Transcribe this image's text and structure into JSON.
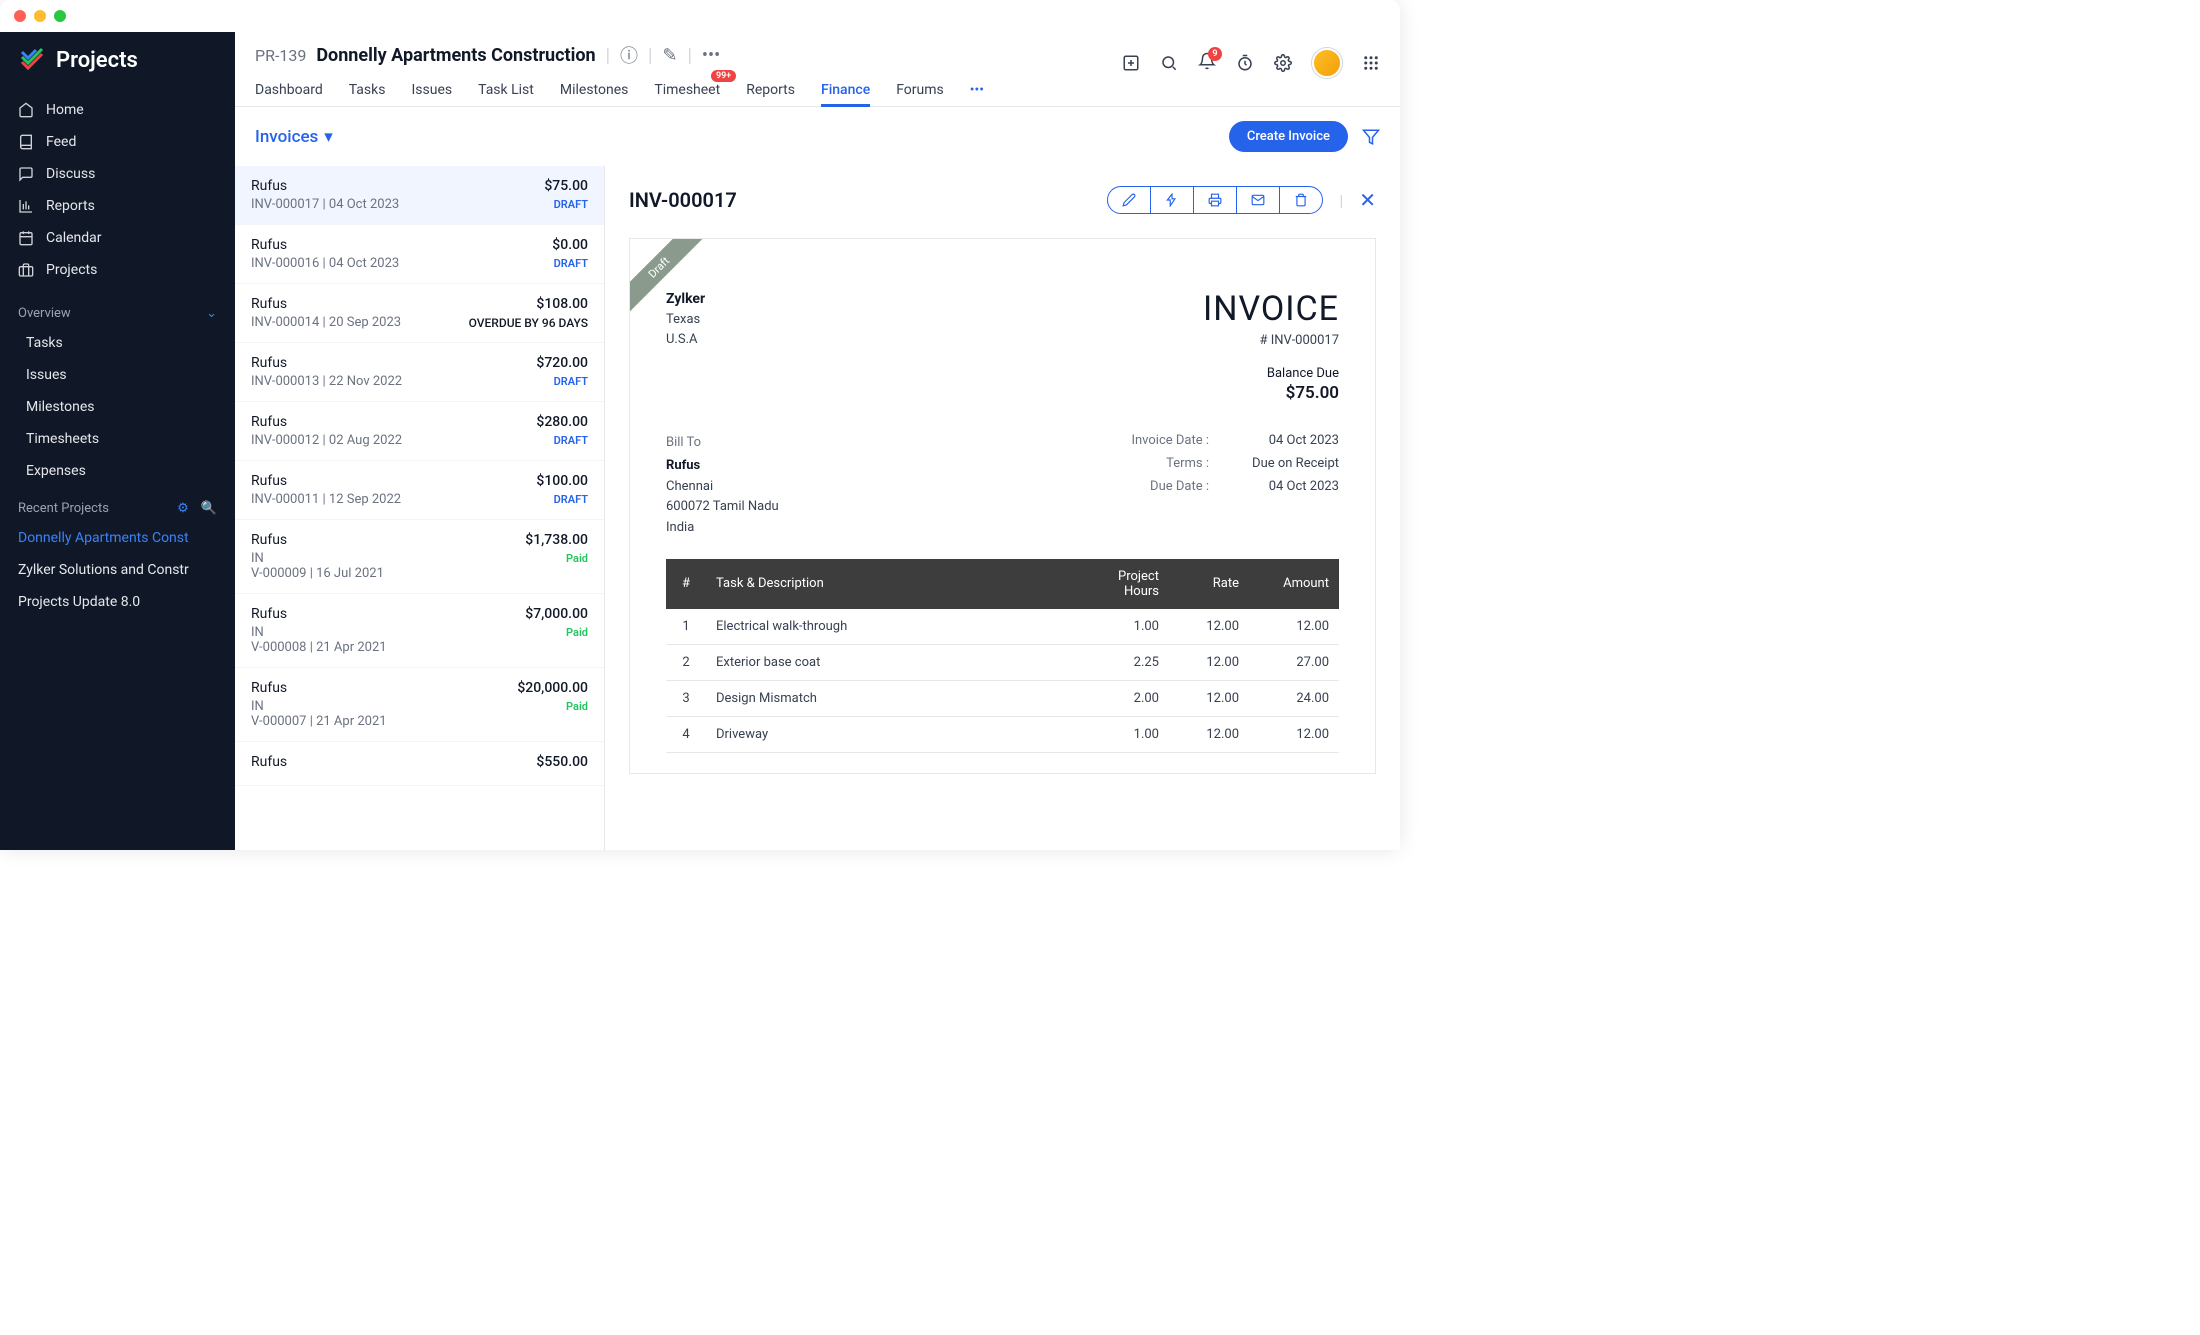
{
  "brand": "Projects",
  "sidebar": {
    "nav": [
      {
        "label": "Home"
      },
      {
        "label": "Feed"
      },
      {
        "label": "Discuss"
      },
      {
        "label": "Reports"
      },
      {
        "label": "Calendar"
      },
      {
        "label": "Projects"
      }
    ],
    "overview_label": "Overview",
    "overview_items": [
      {
        "label": "Tasks"
      },
      {
        "label": "Issues"
      },
      {
        "label": "Milestones"
      },
      {
        "label": "Timesheets"
      },
      {
        "label": "Expenses"
      }
    ],
    "recent_label": "Recent Projects",
    "recent": [
      {
        "label": "Donnelly Apartments Const",
        "active": true
      },
      {
        "label": "Zylker Solutions and Constr"
      },
      {
        "label": "Projects Update 8.0"
      }
    ]
  },
  "project": {
    "id": "PR-139",
    "name": "Donnelly Apartments Construction"
  },
  "tabs": [
    {
      "label": "Dashboard"
    },
    {
      "label": "Tasks"
    },
    {
      "label": "Issues"
    },
    {
      "label": "Task List"
    },
    {
      "label": "Milestones"
    },
    {
      "label": "Timesheet",
      "badge": "99+"
    },
    {
      "label": "Reports"
    },
    {
      "label": "Finance",
      "active": true
    },
    {
      "label": "Forums"
    }
  ],
  "bell_count": "9",
  "subhead": {
    "dropdown": "Invoices",
    "create_btn": "Create Invoice"
  },
  "invoices": [
    {
      "client": "Rufus",
      "amount": "$75.00",
      "meta": "INV-000017 | 04 Oct 2023",
      "status": "DRAFT",
      "status_class": "st-draft",
      "selected": true
    },
    {
      "client": "Rufus",
      "amount": "$0.00",
      "meta": "INV-000016 | 04 Oct 2023",
      "status": "DRAFT",
      "status_class": "st-draft"
    },
    {
      "client": "Rufus",
      "amount": "$108.00",
      "meta": "INV-000014 | 20 Sep 2023",
      "status": "OVERDUE BY 96 DAYS",
      "status_class": "st-overdue"
    },
    {
      "client": "Rufus",
      "amount": "$720.00",
      "meta": "INV-000013 | 22 Nov 2022",
      "status": "DRAFT",
      "status_class": "st-draft"
    },
    {
      "client": "Rufus",
      "amount": "$280.00",
      "meta": "INV-000012 | 02 Aug 2022",
      "status": "DRAFT",
      "status_class": "st-draft"
    },
    {
      "client": "Rufus",
      "amount": "$100.00",
      "meta": "INV-000011 | 12 Sep 2022",
      "status": "DRAFT",
      "status_class": "st-draft"
    },
    {
      "client": "Rufus",
      "amount": "$1,738.00",
      "meta": "IN\nV-000009 | 16 Jul 2021",
      "status": "Paid",
      "status_class": "st-paid",
      "multi": true
    },
    {
      "client": "Rufus",
      "amount": "$7,000.00",
      "meta": "IN\nV-000008 | 21 Apr 2021",
      "status": "Paid",
      "status_class": "st-paid",
      "multi": true
    },
    {
      "client": "Rufus",
      "amount": "$20,000.00",
      "meta": "IN\nV-000007 | 21 Apr 2021",
      "status": "Paid",
      "status_class": "st-paid",
      "multi": true
    },
    {
      "client": "Rufus",
      "amount": "$550.00",
      "meta": "",
      "status": "",
      "status_class": ""
    }
  ],
  "detail": {
    "title": "INV-000017",
    "ribbon": "Draft",
    "from": {
      "name": "Zylker",
      "line1": "Texas",
      "line2": "U.S.A"
    },
    "invoice_word": "INVOICE",
    "invoice_num": "# INV-000017",
    "balance_label": "Balance Due",
    "balance_amount": "$75.00",
    "billto_label": "Bill To",
    "billto": {
      "name": "Rufus",
      "l1": "Chennai",
      "l2": "600072 Tamil Nadu",
      "l3": "India"
    },
    "dates": [
      {
        "k": "Invoice Date :",
        "v": "04 Oct 2023"
      },
      {
        "k": "Terms :",
        "v": "Due on Receipt"
      },
      {
        "k": "Due Date :",
        "v": "04 Oct 2023"
      }
    ],
    "cols": {
      "n": "#",
      "desc": "Task & Description",
      "hrs": "Project\nHours",
      "rate": "Rate",
      "amt": "Amount"
    },
    "items": [
      {
        "n": "1",
        "desc": "Electrical walk-through",
        "hrs": "1.00",
        "rate": "12.00",
        "amt": "12.00"
      },
      {
        "n": "2",
        "desc": "Exterior base coat",
        "hrs": "2.25",
        "rate": "12.00",
        "amt": "27.00"
      },
      {
        "n": "3",
        "desc": "Design Mismatch",
        "hrs": "2.00",
        "rate": "12.00",
        "amt": "24.00"
      },
      {
        "n": "4",
        "desc": "Driveway",
        "hrs": "1.00",
        "rate": "12.00",
        "amt": "12.00"
      }
    ]
  }
}
